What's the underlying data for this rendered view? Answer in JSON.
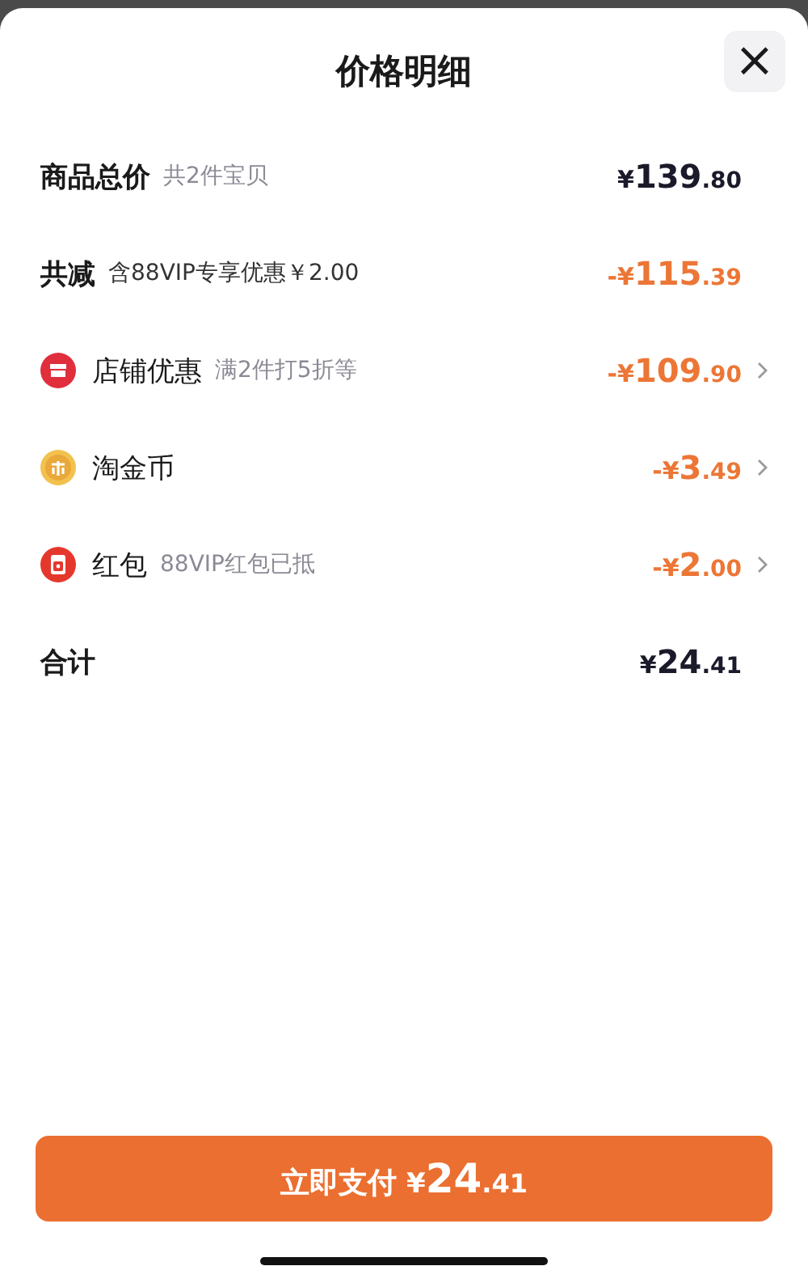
{
  "sheet": {
    "title": "价格明细",
    "close": "×"
  },
  "rows": [
    {
      "kind": "subtotal",
      "label": "商品总价",
      "note": "共2件宝贝",
      "price": {
        "sign": "¥",
        "whole": "139",
        "fraction": ".80"
      },
      "link": false
    },
    {
      "kind": "reduction",
      "label": "共减",
      "note": "含88VIP专享优惠￥2.00",
      "price": {
        "sign": "-¥",
        "whole": "115",
        "fraction": ".39"
      },
      "link": false
    },
    {
      "kind": "discount",
      "label": "店铺优惠",
      "note": "满2件打5折等",
      "price": {
        "sign": "-¥",
        "whole": "109",
        "fraction": ".90"
      },
      "link": true
    },
    {
      "kind": "discount",
      "label": "淘金币",
      "price": {
        "sign": "-¥",
        "whole": "3",
        "fraction": ".49"
      },
      "link": true
    },
    {
      "kind": "discount",
      "label": "红包",
      "note": "88VIP红包已抵",
      "price": {
        "sign": "-¥",
        "whole": "2",
        "fraction": ".00"
      },
      "link": true
    },
    {
      "kind": "total",
      "label": "合计",
      "price": {
        "sign": "¥",
        "whole": "24",
        "fraction": ".41"
      },
      "link": false
    }
  ],
  "pay_button": {
    "label": "立即支付",
    "price": {
      "sign": "¥",
      "whole": "24",
      "fraction": ".41"
    }
  }
}
